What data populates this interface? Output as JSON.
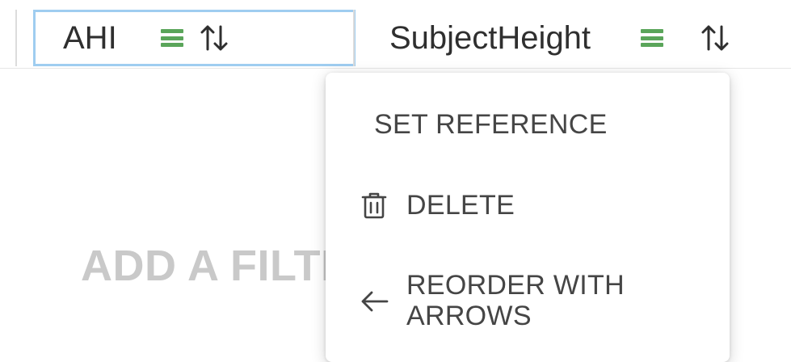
{
  "columns": [
    {
      "name": "AHI",
      "selected": true,
      "menu_icon": "hamburger-menu-icon",
      "sort_icon": "sort-up-down-icon"
    },
    {
      "name": "SubjectHeight",
      "selected": false,
      "menu_icon": "hamburger-menu-icon",
      "sort_icon": "sort-up-down-icon"
    }
  ],
  "placeholder_text": "ADD A FILTER TO THE BOARD",
  "context_menu": {
    "items": [
      {
        "label": "SET REFERENCE",
        "icon": null
      },
      {
        "label": "DELETE",
        "icon": "trash-icon"
      },
      {
        "label": "REORDER WITH ARROWS",
        "icon": "arrow-left-icon"
      }
    ]
  },
  "colors": {
    "selection_border": "#9fcdf0",
    "menu_icon_green": "#5aa55a",
    "placeholder_gray": "#c9c9c9"
  }
}
